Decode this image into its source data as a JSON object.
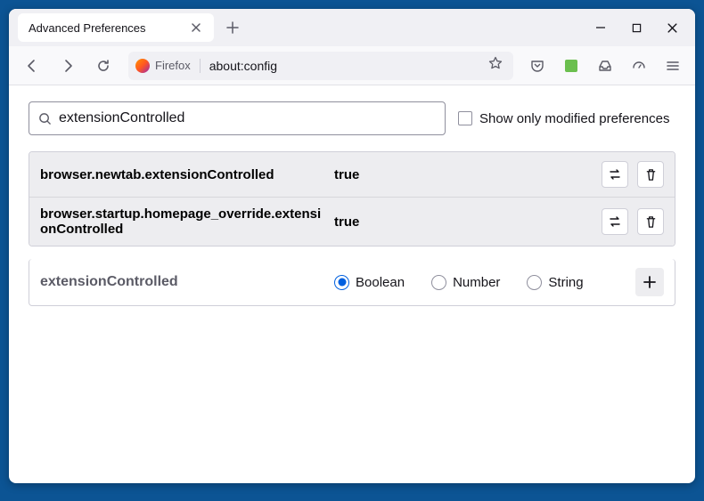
{
  "window": {
    "tab_title": "Advanced Preferences"
  },
  "urlbar": {
    "firefox_label": "Firefox",
    "url": "about:config"
  },
  "search": {
    "value": "extensionControlled",
    "modified_label": "Show only modified preferences"
  },
  "prefs": [
    {
      "name": "browser.newtab.extensionControlled",
      "value": "true"
    },
    {
      "name": "browser.startup.homepage_override.extensionControlled",
      "value": "true"
    }
  ],
  "new_pref": {
    "name": "extensionControlled",
    "types": {
      "boolean": "Boolean",
      "number": "Number",
      "string": "String"
    },
    "selected": "boolean"
  }
}
